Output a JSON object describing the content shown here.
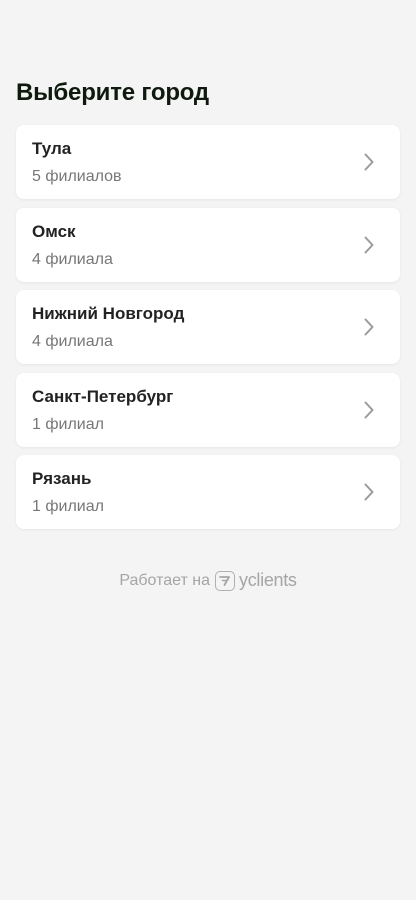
{
  "header": {
    "title": "Выберите город"
  },
  "cities": [
    {
      "name": "Тула",
      "branches": "5 филиалов"
    },
    {
      "name": "Омск",
      "branches": "4 филиала"
    },
    {
      "name": "Нижний Новгород",
      "branches": "4 филиала"
    },
    {
      "name": "Санкт-Петербург",
      "branches": "1 филиал"
    },
    {
      "name": "Рязань",
      "branches": "1 филиал"
    }
  ],
  "footer": {
    "powered_by": "Работает на",
    "brand": "yclients"
  },
  "colors": {
    "background": "#f4f4f4",
    "card": "#ffffff",
    "title": "#0f1a0f",
    "secondary_text": "#777777",
    "chevron": "#9a9a9a"
  },
  "icons": {
    "chevron": "chevron-right-icon",
    "brand": "yclients-logo-icon"
  }
}
